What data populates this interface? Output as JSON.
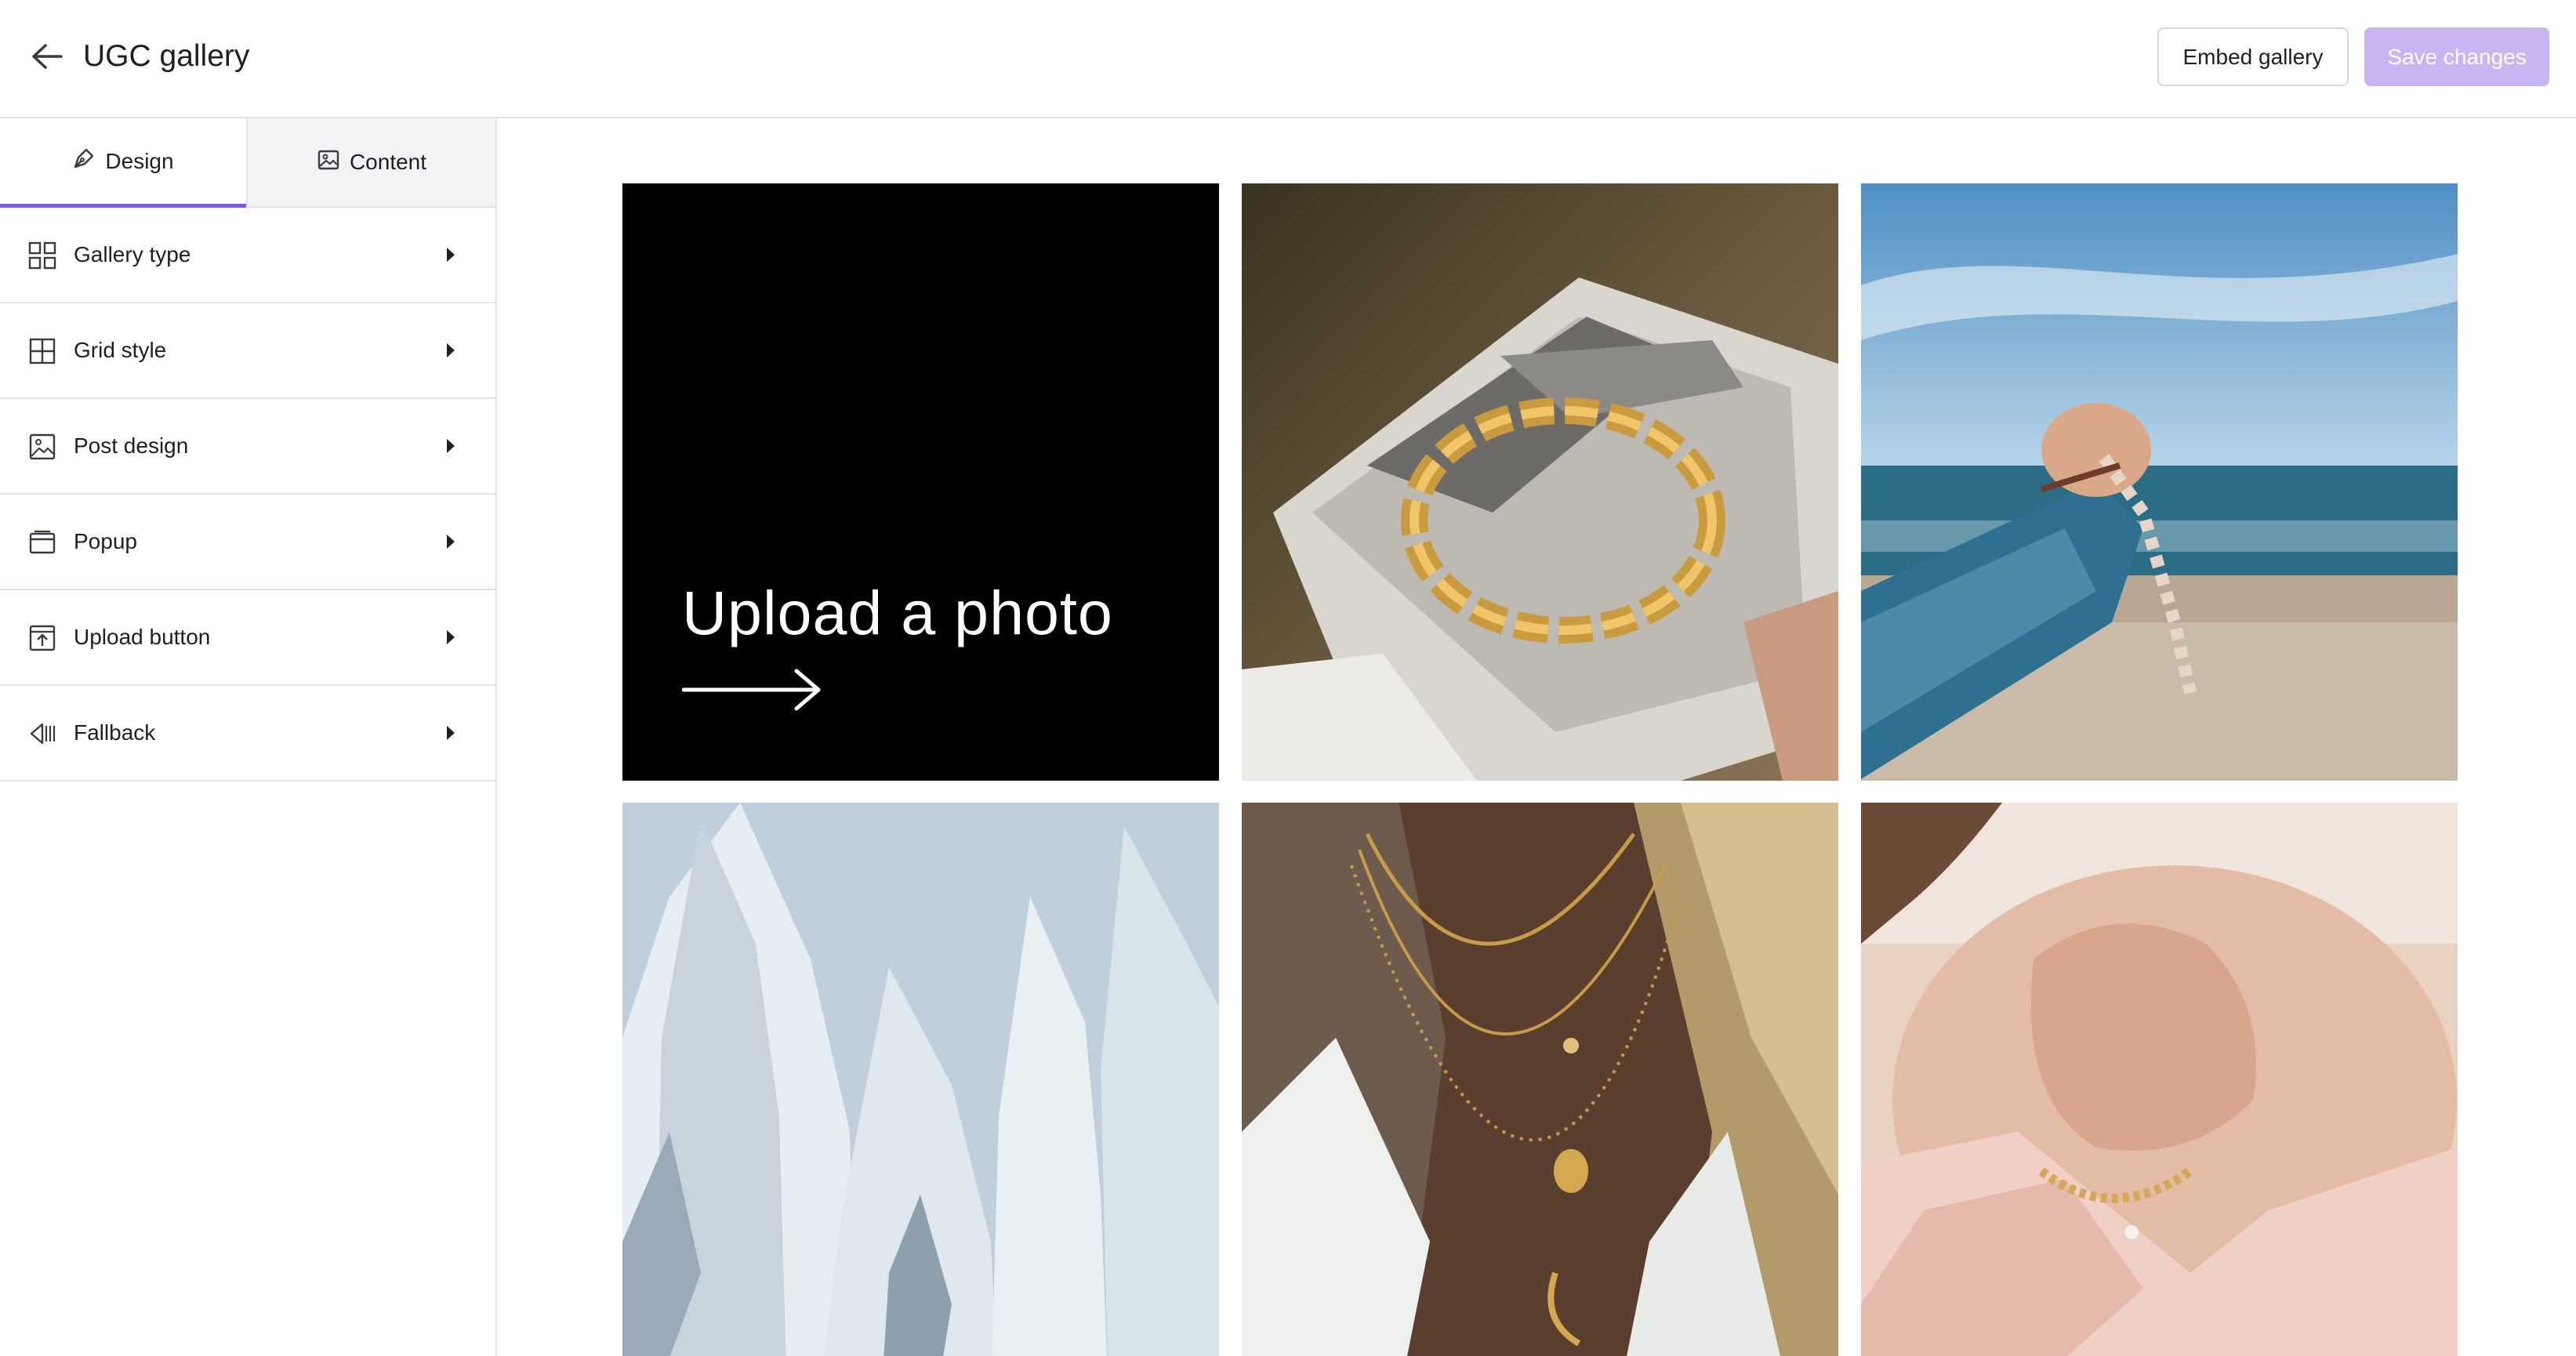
{
  "header": {
    "title": "UGC gallery",
    "embed_label": "Embed gallery",
    "save_label": "Save changes"
  },
  "tabs": [
    {
      "label": "Design",
      "icon": "pen-nib-icon",
      "active": true
    },
    {
      "label": "Content",
      "icon": "image-icon",
      "active": false
    }
  ],
  "menu": [
    {
      "label": "Gallery type",
      "icon": "grid-icon"
    },
    {
      "label": "Grid style",
      "icon": "grid-style-icon"
    },
    {
      "label": "Post design",
      "icon": "image-frame-icon"
    },
    {
      "label": "Popup",
      "icon": "popup-window-icon"
    },
    {
      "label": "Upload button",
      "icon": "upload-icon"
    },
    {
      "label": "Fallback",
      "icon": "fallback-icon"
    }
  ],
  "gallery": {
    "upload_text": "Upload a photo",
    "photos": [
      {
        "subject": "gold chain bracelet on magazine"
      },
      {
        "subject": "hand releasing shells at beach"
      },
      {
        "subject": "snow-covered trees"
      },
      {
        "subject": "layered gold necklaces"
      },
      {
        "subject": "gold bead bracelet on wrist"
      }
    ]
  },
  "colors": {
    "accent": "#7b5ce0",
    "save_button": "#c8b5f1",
    "border": "#e3e3e8"
  }
}
